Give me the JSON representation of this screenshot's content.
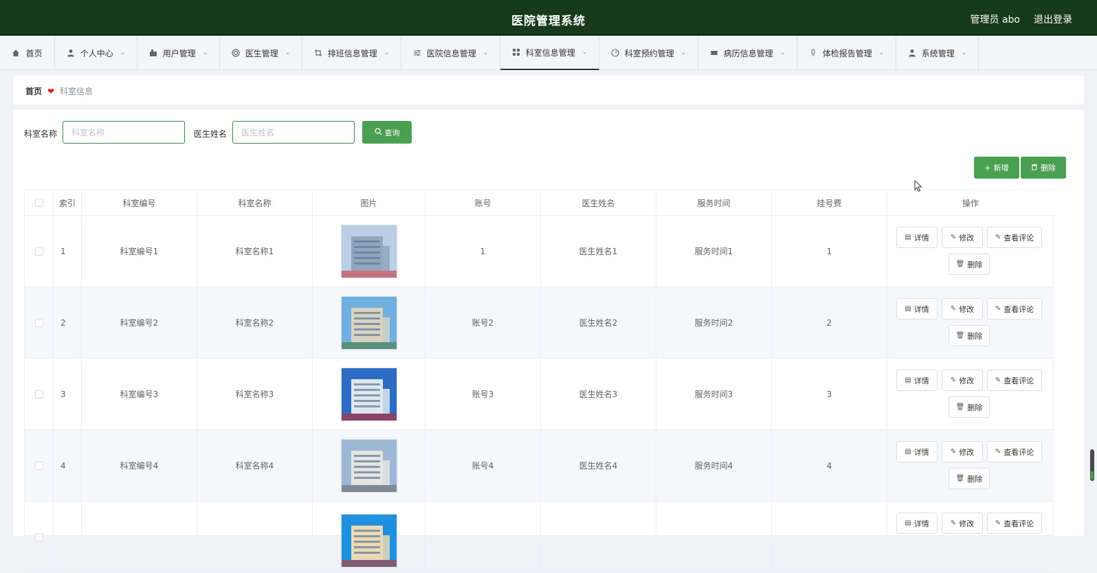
{
  "header": {
    "title": "医院管理系统",
    "admin": "管理员 abo",
    "logout": "退出登录"
  },
  "nav": [
    {
      "label": "首页",
      "icon": "home-icon",
      "dropdown": false
    },
    {
      "label": "个人中心",
      "icon": "user-icon",
      "dropdown": true
    },
    {
      "label": "用户管理",
      "icon": "user-manage-icon",
      "dropdown": true
    },
    {
      "label": "医生管理",
      "icon": "circle-icon",
      "dropdown": true
    },
    {
      "label": "排班信息管理",
      "icon": "crop-icon",
      "dropdown": true
    },
    {
      "label": "医院信息管理",
      "icon": "sliders-icon",
      "dropdown": true
    },
    {
      "label": "科室信息管理",
      "icon": "grid-icon",
      "dropdown": true,
      "active": true
    },
    {
      "label": "科室预约管理",
      "icon": "gauge-icon",
      "dropdown": true
    },
    {
      "label": "病历信息管理",
      "icon": "ticket-icon",
      "dropdown": true
    },
    {
      "label": "体检报告管理",
      "icon": "mic-icon",
      "dropdown": true
    },
    {
      "label": "系统管理",
      "icon": "user-icon",
      "dropdown": true
    }
  ],
  "breadcrumb": {
    "home": "首页",
    "current": "科室信息"
  },
  "search": {
    "dept_label": "科室名称",
    "dept_placeholder": "科室名称",
    "doctor_label": "医生姓名",
    "doctor_placeholder": "医生姓名",
    "query_button": "查询"
  },
  "actions": {
    "add": "新增",
    "delete": "删除"
  },
  "table": {
    "columns": [
      "索引",
      "科室编号",
      "科室名称",
      "图片",
      "账号",
      "医生姓名",
      "服务时间",
      "挂号费",
      "操作"
    ],
    "rows": [
      {
        "index": "1",
        "code": "科室编号1",
        "name": "科室名称1",
        "account": "1",
        "doctor": "医生姓名1",
        "time": "服务时间1",
        "fee": "1"
      },
      {
        "index": "2",
        "code": "科室编号2",
        "name": "科室名称2",
        "account": "账号2",
        "doctor": "医生姓名2",
        "time": "服务时间2",
        "fee": "2"
      },
      {
        "index": "3",
        "code": "科室编号3",
        "name": "科室名称3",
        "account": "账号3",
        "doctor": "医生姓名3",
        "time": "服务时间3",
        "fee": "3"
      },
      {
        "index": "4",
        "code": "科室编号4",
        "name": "科室名称4",
        "account": "账号4",
        "doctor": "医生姓名4",
        "time": "服务时间4",
        "fee": "4"
      },
      {
        "index": "",
        "code": "",
        "name": "",
        "account": "",
        "doctor": "",
        "time": "",
        "fee": ""
      }
    ],
    "row_actions": {
      "detail": "详情",
      "edit": "修改",
      "comments": "查看评论",
      "delete": "删除"
    }
  },
  "colors": {
    "header_bg": "#173a1c",
    "accent_green": "#4aa050",
    "delete_heart": "#e0131a"
  }
}
